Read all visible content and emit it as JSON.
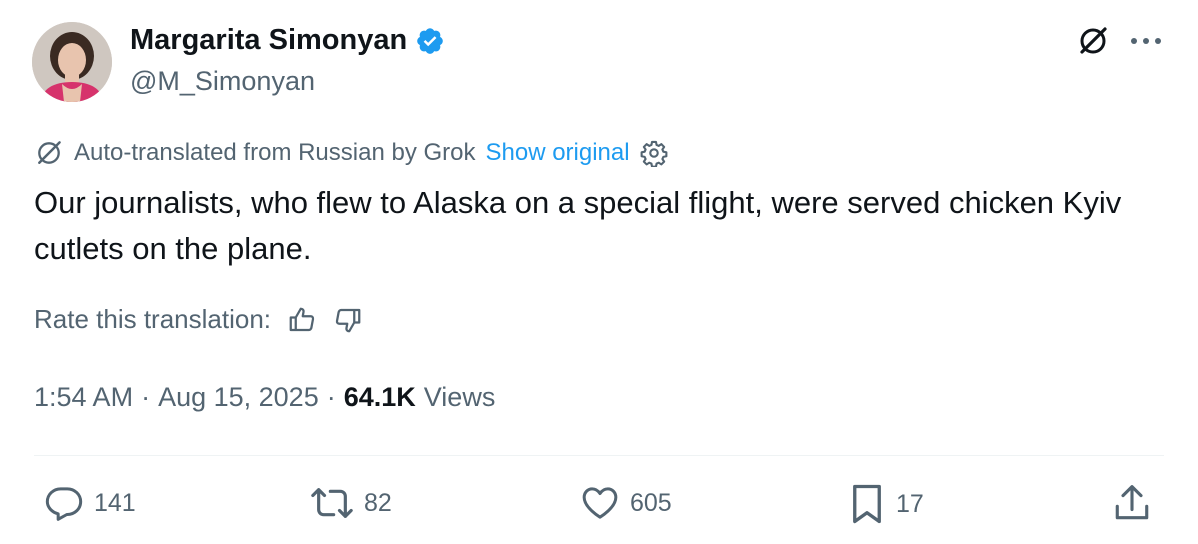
{
  "author": {
    "display_name": "Margarita Simonyan",
    "handle": "@M_Simonyan",
    "verified_icon": "verified-badge-icon"
  },
  "translation": {
    "notice": "Auto-translated from Russian by Grok",
    "show_original_label": "Show original"
  },
  "tweet": {
    "text": "Our journalists, who flew to Alaska on a special flight, were served chicken Kyiv cutlets on the plane."
  },
  "rating": {
    "label": "Rate this translation:"
  },
  "meta": {
    "time": "1:54 AM",
    "separator": "·",
    "date": "Aug 15, 2025",
    "views_count": "64.1K",
    "views_label": "Views"
  },
  "actions": {
    "replies": "141",
    "reposts": "82",
    "likes": "605",
    "bookmarks": "17"
  },
  "colors": {
    "accent": "#1d9bf0",
    "secondary_text": "#536471",
    "primary_text": "#0f1419"
  }
}
